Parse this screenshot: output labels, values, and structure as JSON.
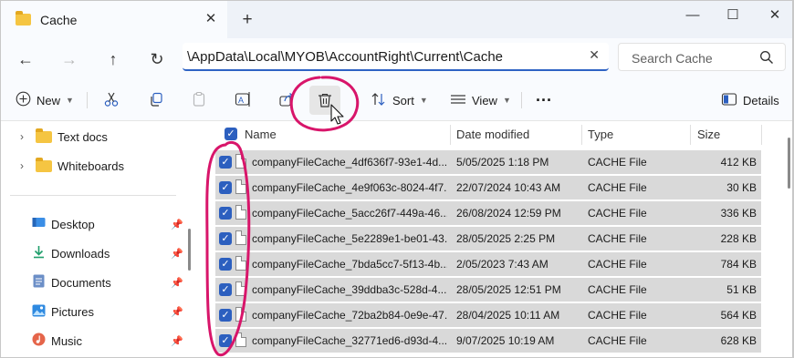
{
  "titlebar": {
    "tab_title": "Cache",
    "tab_close": "✕",
    "new_tab": "+",
    "minimize": "—",
    "maximize": "☐",
    "close": "✕"
  },
  "address": {
    "path": "\\AppData\\Local\\MYOB\\AccountRight\\Current\\Cache",
    "clear": "✕",
    "dropdown": "⌄"
  },
  "search": {
    "placeholder": "Search Cache"
  },
  "nav": {
    "back": "←",
    "forward": "→",
    "up": "↑",
    "refresh": "↻"
  },
  "commands": {
    "new_label": "New",
    "sort_label": "Sort",
    "view_label": "View",
    "more": "···",
    "details_label": "Details"
  },
  "sidebar": {
    "folders": [
      {
        "label": "Text docs"
      },
      {
        "label": "Whiteboards"
      }
    ],
    "quick_access": [
      {
        "label": "Desktop",
        "icon": "desktop-icon"
      },
      {
        "label": "Downloads",
        "icon": "download-icon"
      },
      {
        "label": "Documents",
        "icon": "document-icon"
      },
      {
        "label": "Pictures",
        "icon": "picture-icon"
      },
      {
        "label": "Music",
        "icon": "music-icon"
      }
    ]
  },
  "columns": {
    "name": "Name",
    "date": "Date modified",
    "type": "Type",
    "size": "Size"
  },
  "files": [
    {
      "name": "companyFileCache_4df636f7-93e1-4d...",
      "date": "5/05/2025 1:18 PM",
      "type": "CACHE File",
      "size": "412 KB"
    },
    {
      "name": "companyFileCache_4e9f063c-8024-4f7...",
      "date": "22/07/2024 10:43 AM",
      "type": "CACHE File",
      "size": "30 KB"
    },
    {
      "name": "companyFileCache_5acc26f7-449a-46...",
      "date": "26/08/2024 12:59 PM",
      "type": "CACHE File",
      "size": "336 KB"
    },
    {
      "name": "companyFileCache_5e2289e1-be01-43...",
      "date": "28/05/2025 2:25 PM",
      "type": "CACHE File",
      "size": "228 KB"
    },
    {
      "name": "companyFileCache_7bda5cc7-5f13-4b...",
      "date": "2/05/2023 7:43 AM",
      "type": "CACHE File",
      "size": "784 KB"
    },
    {
      "name": "companyFileCache_39ddba3c-528d-4...",
      "date": "28/05/2025 12:51 PM",
      "type": "CACHE File",
      "size": "51 KB"
    },
    {
      "name": "companyFileCache_72ba2b84-0e9e-47...",
      "date": "28/04/2025 10:11 AM",
      "type": "CACHE File",
      "size": "564 KB"
    },
    {
      "name": "companyFileCache_32771ed6-d93d-4...",
      "date": "9/07/2025 10:19 AM",
      "type": "CACHE File",
      "size": "628 KB"
    }
  ],
  "colors": {
    "accent": "#2c5fbf",
    "annotation": "#d8156a",
    "selection": "#d9d9d9"
  }
}
